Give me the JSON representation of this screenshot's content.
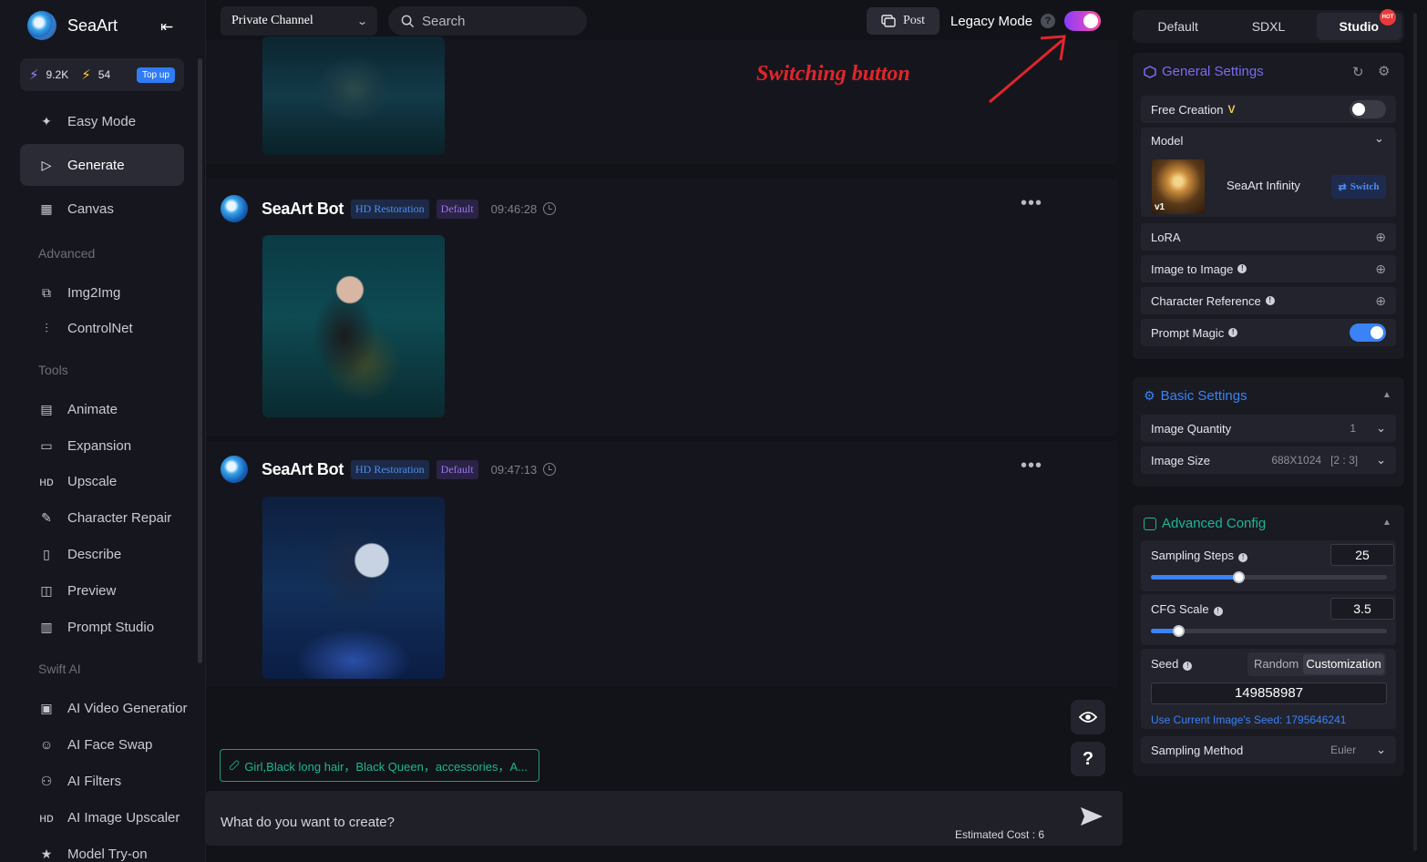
{
  "brand": {
    "name": "SeaArt"
  },
  "credits": {
    "power": "9.2K",
    "energy": "54",
    "topup": "Top up"
  },
  "nav": {
    "items": [
      {
        "label": "Easy Mode"
      },
      {
        "label": "Generate"
      },
      {
        "label": "Canvas"
      }
    ],
    "advanced_title": "Advanced",
    "advanced": [
      {
        "label": "Img2Img"
      },
      {
        "label": "ControlNet"
      }
    ],
    "tools_title": "Tools",
    "tools": [
      {
        "label": "Animate"
      },
      {
        "label": "Expansion"
      },
      {
        "label": "Upscale"
      },
      {
        "label": "Character Repair"
      },
      {
        "label": "Describe"
      },
      {
        "label": "Preview"
      },
      {
        "label": "Prompt Studio"
      }
    ],
    "swift_title": "Swift AI",
    "swift": [
      {
        "label": "AI Video Generatior"
      },
      {
        "label": "AI Face Swap"
      },
      {
        "label": "AI Filters"
      },
      {
        "label": "AI Image Upscaler"
      },
      {
        "label": "Model Try-on"
      }
    ]
  },
  "topbar": {
    "channel": "Private Channel",
    "search_placeholder": "Search",
    "post": "Post",
    "legacy_mode": "Legacy Mode",
    "legacy_enabled": true
  },
  "annotation": {
    "text": "Switching button",
    "color": "#e0262b"
  },
  "messages": [
    {
      "bot": "SeaArt Bot",
      "tag1": "HD Restoration",
      "tag2": "Default",
      "time": "09:46:28"
    },
    {
      "bot": "SeaArt Bot",
      "tag1": "HD Restoration",
      "tag2": "Default",
      "time": "09:47:13"
    }
  ],
  "prompt_chip": "Girl,Black long hair，Black Queen，accessories，A...",
  "composer": {
    "placeholder": "What do you want to create?",
    "cost": "Estimated Cost : 6"
  },
  "side_buttons": {
    "help": "?"
  },
  "right_panel": {
    "tabs": [
      {
        "label": "Default"
      },
      {
        "label": "SDXL"
      },
      {
        "label": "Studio"
      }
    ],
    "hot_badge": "HOT",
    "general": {
      "title": "General Settings",
      "free_creation": "Free Creation",
      "free_creation_on": false,
      "model_label": "Model",
      "model_name": "SeaArt Infinity",
      "model_version": "v1",
      "switch": "Switch",
      "lora": "LoRA",
      "img2img": "Image to Image",
      "char_ref": "Character Reference",
      "prompt_magic": "Prompt Magic",
      "prompt_magic_on": true
    },
    "basic": {
      "title": "Basic Settings",
      "quantity_label": "Image Quantity",
      "quantity": "1",
      "size_label": "Image Size",
      "size": "688X1024",
      "ratio": "[2 : 3]"
    },
    "advanced": {
      "title": "Advanced Config",
      "steps_label": "Sampling Steps",
      "steps": "25",
      "steps_fraction": 0.37,
      "cfg_label": "CFG Scale",
      "cfg": "3.5",
      "cfg_fraction": 0.115,
      "seed_label": "Seed",
      "seed_random": "Random",
      "seed_custom": "Customization",
      "seed_value": "149858987",
      "seed_link": "Use Current Image's Seed: 1795646241",
      "method_label": "Sampling Method",
      "method": "Euler"
    }
  },
  "colors": {
    "accent": "#3b82f6",
    "teal": "#1fb592",
    "purple_tag": "#9878f0"
  }
}
